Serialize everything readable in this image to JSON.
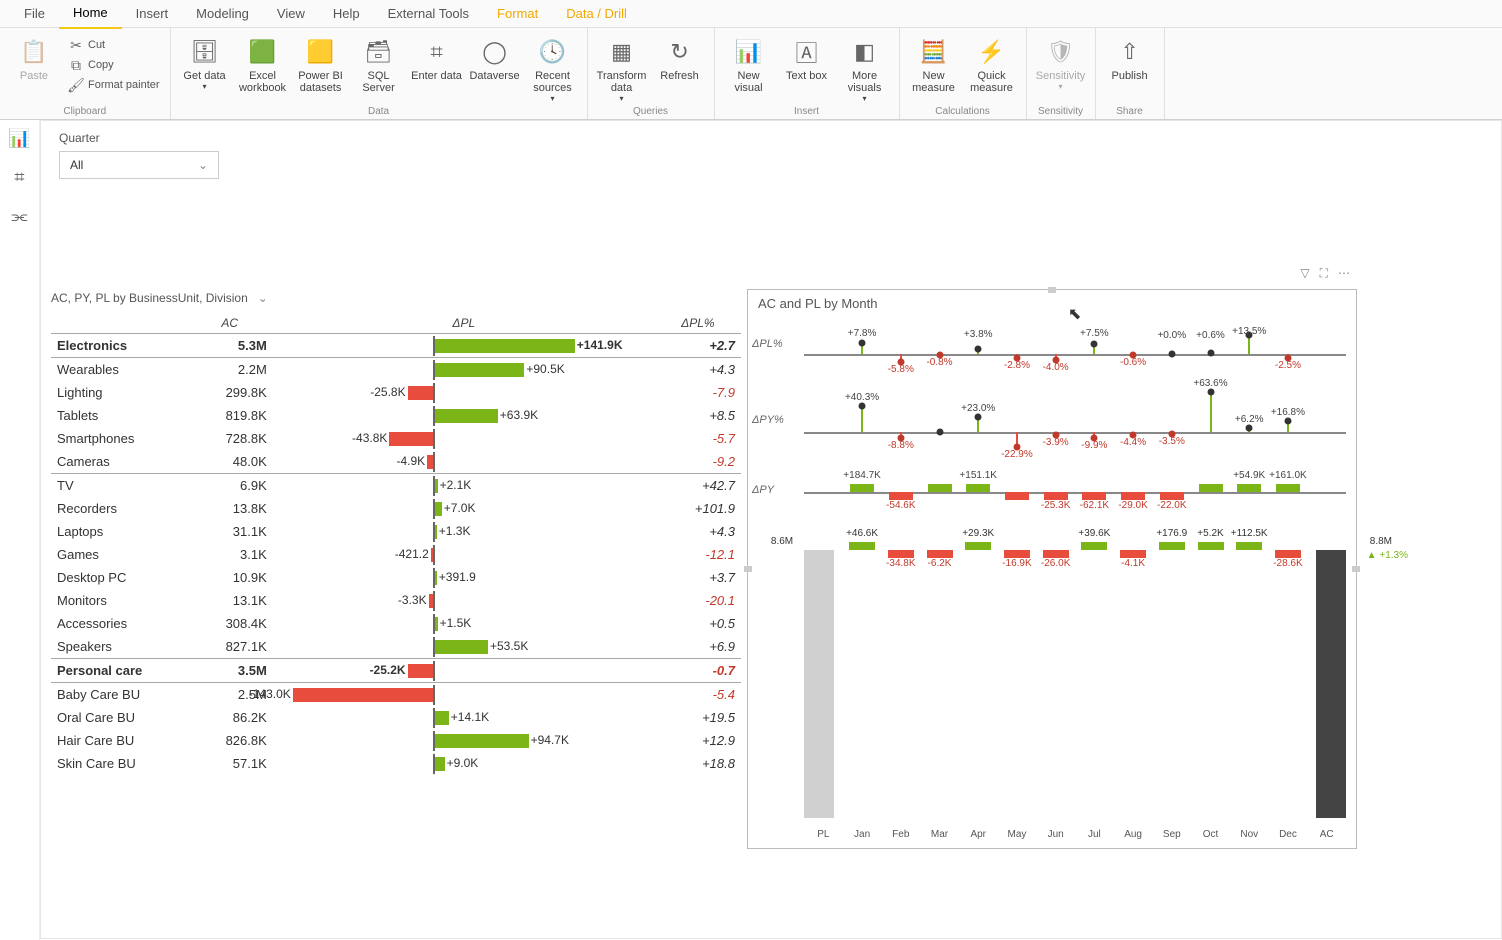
{
  "ribbon": {
    "tabs": [
      "File",
      "Home",
      "Insert",
      "Modeling",
      "View",
      "Help",
      "External Tools",
      "Format",
      "Data / Drill"
    ],
    "active": "Home",
    "clipboard": {
      "paste": "Paste",
      "cut": "Cut",
      "copy": "Copy",
      "formatpainter": "Format painter",
      "group": "Clipboard"
    },
    "data": {
      "group": "Data",
      "getdata": "Get data",
      "excel": "Excel workbook",
      "datasets": "Power BI datasets",
      "sql": "SQL Server",
      "enterdata": "Enter data",
      "dataverse": "Dataverse",
      "recent": "Recent sources"
    },
    "queries": {
      "group": "Queries",
      "transform": "Transform data",
      "refresh": "Refresh"
    },
    "insert": {
      "group": "Insert",
      "newvisual": "New visual",
      "textbox": "Text box",
      "morevisuals": "More visuals"
    },
    "calculations": {
      "group": "Calculations",
      "newmeasure": "New measure",
      "quickmeasure": "Quick measure"
    },
    "sensitivity": {
      "group": "Sensitivity",
      "btn": "Sensitivity"
    },
    "share": {
      "group": "Share",
      "publish": "Publish"
    }
  },
  "sidebar_views": [
    "report",
    "data",
    "model"
  ],
  "slicer": {
    "label": "Quarter",
    "value": "All"
  },
  "matrix": {
    "title": "AC, PY, PL by BusinessUnit, Division",
    "cols": {
      "ac": "AC",
      "dpl": "ΔPL",
      "dplpct": "ΔPL%"
    },
    "rows": [
      {
        "name": "Electronics",
        "ac": "5.3M",
        "dpl": "+141.9K",
        "pct": "+2.7",
        "hdr": true,
        "bar": 100,
        "dir": "p"
      },
      {
        "name": "Wearables",
        "ac": "2.2M",
        "dpl": "+90.5K",
        "pct": "+4.3",
        "bar": 64,
        "dir": "p"
      },
      {
        "name": "Lighting",
        "ac": "299.8K",
        "dpl": "-25.8K",
        "pct": "-7.9",
        "bar": 18,
        "dir": "n"
      },
      {
        "name": "Tablets",
        "ac": "819.8K",
        "dpl": "+63.9K",
        "pct": "+8.5",
        "bar": 45,
        "dir": "p"
      },
      {
        "name": "Smartphones",
        "ac": "728.8K",
        "dpl": "-43.8K",
        "pct": "-5.7",
        "bar": 31,
        "dir": "n"
      },
      {
        "name": "Cameras",
        "ac": "48.0K",
        "dpl": "-4.9K",
        "pct": "-9.2",
        "bar": 4,
        "dir": "n",
        "div": true
      },
      {
        "name": "TV",
        "ac": "6.9K",
        "dpl": "+2.1K",
        "pct": "+42.7",
        "bar": 2,
        "dir": "p"
      },
      {
        "name": "Recorders",
        "ac": "13.8K",
        "dpl": "+7.0K",
        "pct": "+101.9",
        "bar": 5,
        "dir": "p"
      },
      {
        "name": "Laptops",
        "ac": "31.1K",
        "dpl": "+1.3K",
        "pct": "+4.3",
        "bar": 1,
        "dir": "p"
      },
      {
        "name": "Games",
        "ac": "3.1K",
        "dpl": "-421.2",
        "pct": "-12.1",
        "bar": 1,
        "dir": "n"
      },
      {
        "name": "Desktop PC",
        "ac": "10.9K",
        "dpl": "+391.9",
        "pct": "+3.7",
        "bar": 1,
        "dir": "p"
      },
      {
        "name": "Monitors",
        "ac": "13.1K",
        "dpl": "-3.3K",
        "pct": "-20.1",
        "bar": 3,
        "dir": "n"
      },
      {
        "name": "Accessories",
        "ac": "308.4K",
        "dpl": "+1.5K",
        "pct": "+0.5",
        "bar": 2,
        "dir": "p"
      },
      {
        "name": "Speakers",
        "ac": "827.1K",
        "dpl": "+53.5K",
        "pct": "+6.9",
        "bar": 38,
        "dir": "p",
        "div": true
      },
      {
        "name": "Personal care",
        "ac": "3.5M",
        "dpl": "-25.2K",
        "pct": "-0.7",
        "hdr": true,
        "bar": 18,
        "dir": "n"
      },
      {
        "name": "Baby Care BU",
        "ac": "2.5M",
        "dpl": "-143.0K",
        "pct": "-5.4",
        "bar": 100,
        "dir": "n"
      },
      {
        "name": "Oral Care BU",
        "ac": "86.2K",
        "dpl": "+14.1K",
        "pct": "+19.5",
        "bar": 10,
        "dir": "p"
      },
      {
        "name": "Hair Care BU",
        "ac": "826.8K",
        "dpl": "+94.7K",
        "pct": "+12.9",
        "bar": 67,
        "dir": "p"
      },
      {
        "name": "Skin Care BU",
        "ac": "57.1K",
        "dpl": "+9.0K",
        "pct": "+18.8",
        "bar": 7,
        "dir": "p"
      }
    ]
  },
  "rightchart": {
    "title": "AC and PL by Month",
    "months": [
      "PL",
      "Jan",
      "Feb",
      "Mar",
      "Apr",
      "May",
      "Jun",
      "Jul",
      "Aug",
      "Sep",
      "Oct",
      "Nov",
      "Dec",
      "AC"
    ],
    "strips": {
      "dplpct": {
        "label": "ΔPL%",
        "points": [
          {
            "m": "Jan",
            "v": "+7.8%",
            "dir": "p"
          },
          {
            "m": "Feb",
            "v": "-5.8%",
            "dir": "n"
          },
          {
            "m": "Mar",
            "v": "-0.8%",
            "dir": "n"
          },
          {
            "m": "Apr",
            "v": "+3.8%",
            "dir": "p"
          },
          {
            "m": "May",
            "v": "-2.8%",
            "dir": "n"
          },
          {
            "m": "Jun",
            "v": "-4.0%",
            "dir": "n"
          },
          {
            "m": "Jul",
            "v": "+7.5%",
            "dir": "p"
          },
          {
            "m": "Aug",
            "v": "-0.6%",
            "dir": "n"
          },
          {
            "m": "Sep",
            "v": "+0.0%",
            "dir": "p"
          },
          {
            "m": "Oct",
            "v": "+0.6%",
            "dir": "p"
          },
          {
            "m": "Nov",
            "v": "+13.5%",
            "dir": "p"
          },
          {
            "m": "Dec",
            "v": "-2.5%",
            "dir": "n"
          }
        ]
      },
      "dpypct": {
        "label": "ΔPY%",
        "points": [
          {
            "m": "Jan",
            "v": "+40.3%",
            "dir": "p"
          },
          {
            "m": "Feb",
            "v": "-8.8%",
            "dir": "n"
          },
          {
            "m": "Mar",
            "v": "",
            "dir": "p"
          },
          {
            "m": "Apr",
            "v": "+23.0%",
            "dir": "p"
          },
          {
            "m": "May",
            "v": "-22.9%",
            "dir": "n"
          },
          {
            "m": "Jun",
            "v": "-3.9%",
            "dir": "n"
          },
          {
            "m": "Jul",
            "v": "-9.9%",
            "dir": "n"
          },
          {
            "m": "Aug",
            "v": "-4.4%",
            "dir": "n"
          },
          {
            "m": "Sep",
            "v": "-3.5%",
            "dir": "n"
          },
          {
            "m": "Oct",
            "v": "+63.6%",
            "dir": "p"
          },
          {
            "m": "Nov",
            "v": "+6.2%",
            "dir": "p"
          },
          {
            "m": "Dec",
            "v": "+16.8%",
            "dir": "p"
          }
        ]
      },
      "dpy": {
        "label": "ΔPY",
        "bars": [
          {
            "m": "Jan",
            "v": "+184.7K",
            "dir": "p"
          },
          {
            "m": "Feb",
            "v": "-54.6K",
            "dir": "n"
          },
          {
            "m": "Mar",
            "v": "",
            "dir": "p"
          },
          {
            "m": "Apr",
            "v": "+151.1K",
            "dir": "p"
          },
          {
            "m": "May",
            "v": "",
            "dir": "n"
          },
          {
            "m": "Jun",
            "v": "-25.3K",
            "dir": "n"
          },
          {
            "m": "Jul",
            "v": "-62.1K",
            "dir": "n"
          },
          {
            "m": "Aug",
            "v": "-29.0K",
            "dir": "n"
          },
          {
            "m": "Sep",
            "v": "-22.0K",
            "dir": "n"
          },
          {
            "m": "Oct",
            "v": "",
            "dir": "p"
          },
          {
            "m": "Nov",
            "v": "+54.9K",
            "dir": "p"
          },
          {
            "m": "Dec",
            "v": "+161.0K",
            "dir": "p"
          }
        ]
      }
    },
    "waterfall": {
      "pl": "8.6M",
      "ac": "8.8M",
      "pct": "+1.3%",
      "steps": [
        {
          "m": "Jan",
          "v": "+46.6K",
          "dir": "p"
        },
        {
          "m": "Feb",
          "v": "-34.8K",
          "dir": "n"
        },
        {
          "m": "Mar",
          "v": "-6.2K",
          "dir": "n"
        },
        {
          "m": "Apr",
          "v": "+29.3K",
          "dir": "p"
        },
        {
          "m": "May",
          "v": "-16.9K",
          "dir": "n"
        },
        {
          "m": "Jun",
          "v": "-26.0K",
          "dir": "n"
        },
        {
          "m": "Jul",
          "v": "+39.6K",
          "dir": "p"
        },
        {
          "m": "Aug",
          "v": "-4.1K",
          "dir": "n"
        },
        {
          "m": "Sep",
          "v": "+176.9",
          "dir": "p"
        },
        {
          "m": "Oct",
          "v": "+5.2K",
          "dir": "p"
        },
        {
          "m": "Nov",
          "v": "+112.5K",
          "dir": "p"
        },
        {
          "m": "Dec",
          "v": "-28.6K",
          "dir": "n"
        }
      ]
    }
  },
  "chart_data": {
    "matrix": {
      "type": "bar",
      "title": "AC, PY, PL by BusinessUnit, Division",
      "columns": [
        "BusinessUnit/Division",
        "AC",
        "ΔPL",
        "ΔPL%"
      ],
      "rows": [
        [
          "Electronics",
          "5.3M",
          141900,
          2.7
        ],
        [
          "Wearables",
          "2.2M",
          90500,
          4.3
        ],
        [
          "Lighting",
          "299.8K",
          -25800,
          -7.9
        ],
        [
          "Tablets",
          "819.8K",
          63900,
          8.5
        ],
        [
          "Smartphones",
          "728.8K",
          -43800,
          -5.7
        ],
        [
          "Cameras",
          "48.0K",
          -4900,
          -9.2
        ],
        [
          "TV",
          "6.9K",
          2100,
          42.7
        ],
        [
          "Recorders",
          "13.8K",
          7000,
          101.9
        ],
        [
          "Laptops",
          "31.1K",
          1300,
          4.3
        ],
        [
          "Games",
          "3.1K",
          -421.2,
          -12.1
        ],
        [
          "Desktop PC",
          "10.9K",
          391.9,
          3.7
        ],
        [
          "Monitors",
          "13.1K",
          -3300,
          -20.1
        ],
        [
          "Accessories",
          "308.4K",
          1500,
          0.5
        ],
        [
          "Speakers",
          "827.1K",
          53500,
          6.9
        ],
        [
          "Personal care",
          "3.5M",
          -25200,
          -0.7
        ],
        [
          "Baby Care BU",
          "2.5M",
          -143000,
          -5.4
        ],
        [
          "Oral Care BU",
          "86.2K",
          14100,
          19.5
        ],
        [
          "Hair Care BU",
          "826.8K",
          94700,
          12.9
        ],
        [
          "Skin Care BU",
          "57.1K",
          9000,
          18.8
        ]
      ]
    },
    "monthly": {
      "type": "line",
      "title": "AC and PL by Month",
      "categories": [
        "Jan",
        "Feb",
        "Mar",
        "Apr",
        "May",
        "Jun",
        "Jul",
        "Aug",
        "Sep",
        "Oct",
        "Nov",
        "Dec"
      ],
      "series": [
        {
          "name": "ΔPL%",
          "values": [
            7.8,
            -5.8,
            -0.8,
            3.8,
            -2.8,
            -4.0,
            7.5,
            -0.6,
            0.0,
            0.6,
            13.5,
            -2.5
          ]
        },
        {
          "name": "ΔPY%",
          "values": [
            40.3,
            -8.8,
            null,
            23.0,
            -22.9,
            -3.9,
            -9.9,
            -4.4,
            -3.5,
            63.6,
            6.2,
            16.8
          ]
        },
        {
          "name": "ΔPY",
          "values": [
            184700,
            -54600,
            null,
            151100,
            null,
            -25300,
            -62100,
            -29000,
            -22000,
            null,
            54900,
            161000
          ]
        },
        {
          "name": "Waterfall ΔPL",
          "values": [
            46600,
            -34800,
            -6200,
            29300,
            -16900,
            -26000,
            39600,
            -4100,
            176.9,
            5200,
            112500,
            -28600
          ]
        }
      ],
      "totals": {
        "PL": 8600000,
        "AC": 8800000,
        "pct": 1.3
      }
    }
  }
}
